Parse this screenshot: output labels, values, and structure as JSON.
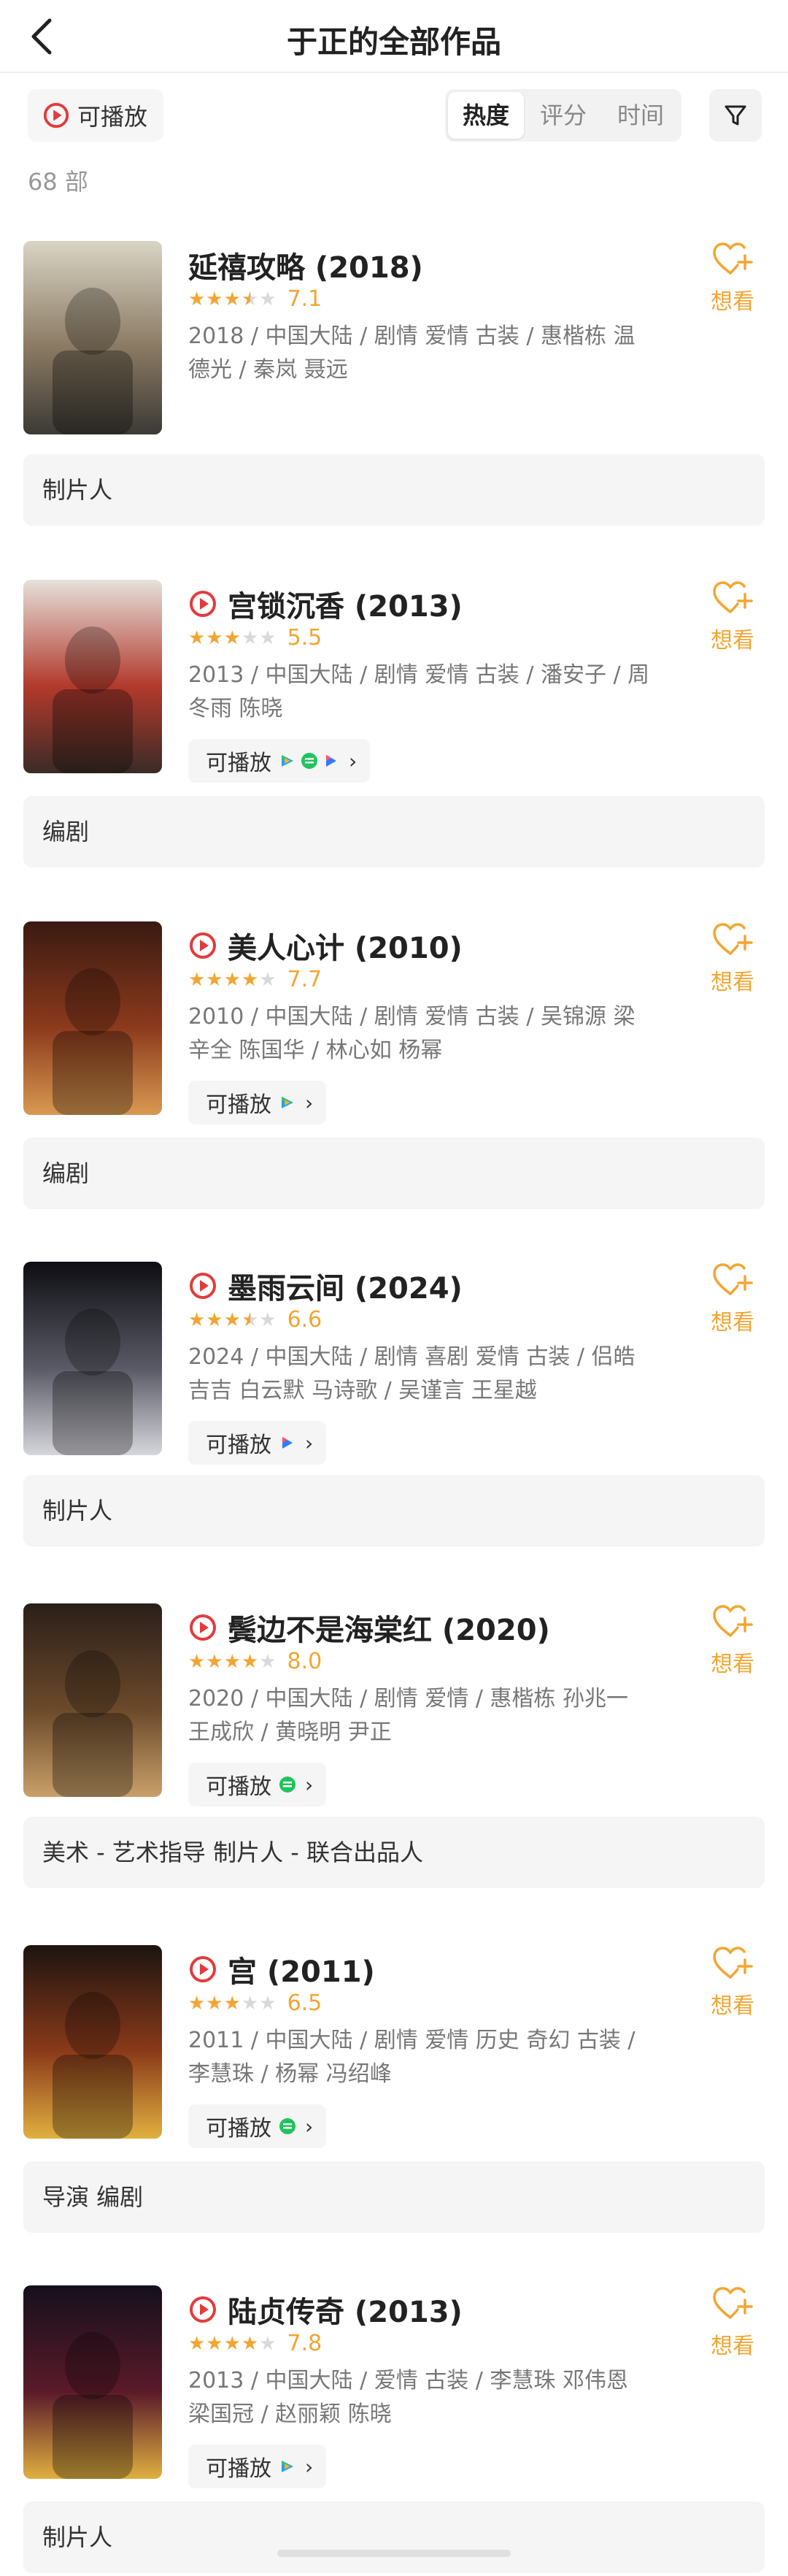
{
  "header": {
    "title": "于正的全部作品"
  },
  "filters": {
    "playable_label": "可播放",
    "sort_tabs": [
      "热度",
      "评分",
      "时间"
    ],
    "active_sort": "热度"
  },
  "count_label": "68 部",
  "colors": {
    "accent": "#f3a531",
    "play_red": "#e33b3b",
    "chip_bg": "#f5f5f5"
  },
  "works": [
    {
      "title": "延禧攻略 (2018)",
      "has_play_icon": false,
      "stars": 3.5,
      "score": "7.1",
      "meta": "2018 / 中国大陆 / 剧情 爱情 古装 / 惠楷栋 温德光 / 秦岚 聂远",
      "playable": false,
      "platforms": [],
      "want_label": "想看",
      "role": "制片人"
    },
    {
      "title": "宫锁沉香 (2013)",
      "has_play_icon": true,
      "stars": 3,
      "score": "5.5",
      "meta": "2013 / 中国大陆 / 剧情 爱情 古装 / 潘安子 / 周冬雨 陈晓",
      "playable": true,
      "play_label": "可播放",
      "platforms": [
        "tencent-video-icon",
        "iqiyi-icon",
        "bilibili-icon"
      ],
      "want_label": "想看",
      "role": "编剧"
    },
    {
      "title": "美人心计 (2010)",
      "has_play_icon": true,
      "stars": 4,
      "score": "7.7",
      "meta": "2010 / 中国大陆 / 剧情 爱情 古装 / 吴锦源 梁辛全 陈国华 / 林心如 杨幂",
      "playable": true,
      "play_label": "可播放",
      "platforms": [
        "tencent-video-icon"
      ],
      "want_label": "想看",
      "role": "编剧"
    },
    {
      "title": "墨雨云间 (2024)",
      "has_play_icon": true,
      "stars": 3.5,
      "score": "6.6",
      "meta": "2024 / 中国大陆 / 剧情 喜剧 爱情 古装 / 侣皓吉吉 白云默 马诗歌 / 吴谨言 王星越",
      "playable": true,
      "play_label": "可播放",
      "platforms": [
        "bilibili-icon"
      ],
      "want_label": "想看",
      "role": "制片人"
    },
    {
      "title": "鬓边不是海棠红 (2020)",
      "has_play_icon": true,
      "stars": 4,
      "score": "8.0",
      "meta": "2020 / 中国大陆 / 剧情 爱情 / 惠楷栋 孙兆一 王成欣 / 黄晓明 尹正",
      "playable": true,
      "play_label": "可播放",
      "platforms": [
        "iqiyi-icon"
      ],
      "want_label": "想看",
      "role": "美术 - 艺术指导 制片人 - 联合出品人"
    },
    {
      "title": "宫 (2011)",
      "has_play_icon": true,
      "stars": 3,
      "score": "6.5",
      "meta": "2011 / 中国大陆 / 剧情 爱情 历史 奇幻 古装 / 李慧珠 / 杨幂 冯绍峰",
      "playable": true,
      "play_label": "可播放",
      "platforms": [
        "iqiyi-icon"
      ],
      "want_label": "想看",
      "role": "导演 编剧"
    },
    {
      "title": "陆贞传奇 (2013)",
      "has_play_icon": true,
      "stars": 4,
      "score": "7.8",
      "meta": "2013 / 中国大陆 / 爱情 古装 / 李慧珠 邓伟恩 梁国冠 / 赵丽颖 陈晓",
      "playable": true,
      "play_label": "可播放",
      "platforms": [
        "tencent-video-icon"
      ],
      "want_label": "想看",
      "role": "制片人"
    }
  ]
}
